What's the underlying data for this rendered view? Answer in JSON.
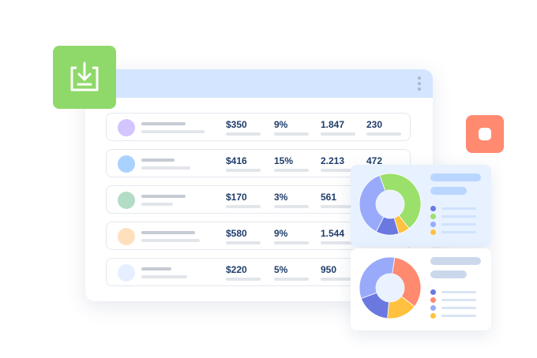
{
  "table": {
    "rows": [
      {
        "avatar_color": "#d4c4ff",
        "price": "$350",
        "percent": "9%",
        "amount": "1.847",
        "count": "230"
      },
      {
        "avatar_color": "#a9d2ff",
        "price": "$416",
        "percent": "15%",
        "amount": "2.213",
        "count": "472"
      },
      {
        "avatar_color": "#b3dcc6",
        "price": "$170",
        "percent": "3%",
        "amount": "561",
        "count": ""
      },
      {
        "avatar_color": "#ffe0bd",
        "price": "$580",
        "percent": "9%",
        "amount": "1.544",
        "count": ""
      },
      {
        "avatar_color": "#e6efff",
        "price": "$220",
        "percent": "5%",
        "amount": "950",
        "count": ""
      }
    ]
  },
  "colors": {
    "header": "#d3e5ff",
    "download_tile": "#8fd96b",
    "stop_tile": "#ff8a70",
    "text": "#1f3d6b"
  },
  "cards": [
    {
      "background": "#e7f1ff",
      "bar_color": "#b9d6ff",
      "legend_line_color": "#cfe2ff",
      "slices": [
        {
          "color": "#9be06a",
          "value": 0.45
        },
        {
          "color": "#ffc13f",
          "value": 0.06
        },
        {
          "color": "#6a78e0",
          "value": 0.12
        },
        {
          "color": "#99aafb",
          "value": 0.37
        }
      ],
      "legend_colors": [
        "#6a78e0",
        "#9be06a",
        "#99aafb",
        "#ffc13f"
      ]
    },
    {
      "background": "#ffffff",
      "bar_color": "#cbd8ec",
      "legend_line_color": "#d9e4f3",
      "slices": [
        {
          "color": "#ff8a70",
          "value": 0.33
        },
        {
          "color": "#ffc13f",
          "value": 0.16
        },
        {
          "color": "#6a78e0",
          "value": 0.18
        },
        {
          "color": "#99aafb",
          "value": 0.33
        }
      ],
      "legend_colors": [
        "#6a78e0",
        "#ff8a70",
        "#99aafb",
        "#ffc13f"
      ]
    }
  ],
  "icons": {
    "download": "download-icon",
    "stop": "stop-icon",
    "menu": "kebab-menu-icon"
  }
}
